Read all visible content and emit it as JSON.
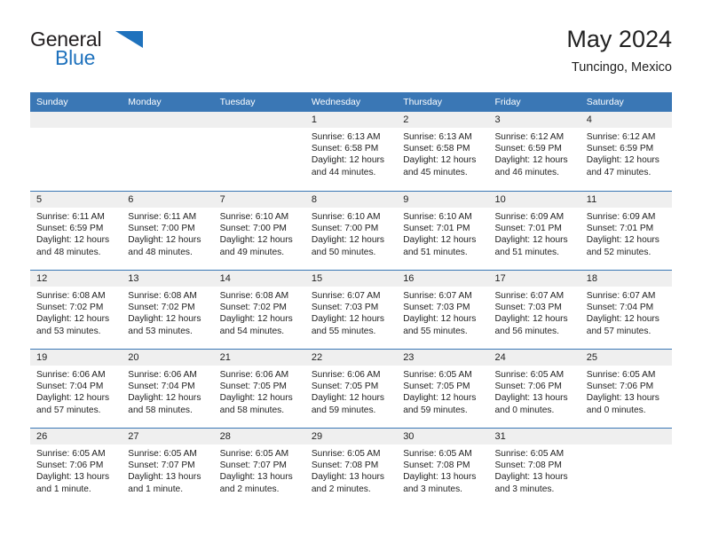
{
  "brand": {
    "name_part1": "General",
    "name_part2": "Blue",
    "accent_color": "#1f72bd",
    "logo_icon": "triangle-icon"
  },
  "header": {
    "title": "May 2024",
    "subtitle": "Tuncingo, Mexico"
  },
  "theme": {
    "header_bg": "#3a77b5",
    "daynum_bg": "#efefef",
    "divider": "#3a77b5",
    "text": "#222222"
  },
  "calendar": {
    "weekday_headers": [
      "Sunday",
      "Monday",
      "Tuesday",
      "Wednesday",
      "Thursday",
      "Friday",
      "Saturday"
    ],
    "weeks": [
      [
        {
          "day": "",
          "lines": []
        },
        {
          "day": "",
          "lines": []
        },
        {
          "day": "",
          "lines": []
        },
        {
          "day": "1",
          "lines": [
            "Sunrise: 6:13 AM",
            "Sunset: 6:58 PM",
            "Daylight: 12 hours",
            "and 44 minutes."
          ]
        },
        {
          "day": "2",
          "lines": [
            "Sunrise: 6:13 AM",
            "Sunset: 6:58 PM",
            "Daylight: 12 hours",
            "and 45 minutes."
          ]
        },
        {
          "day": "3",
          "lines": [
            "Sunrise: 6:12 AM",
            "Sunset: 6:59 PM",
            "Daylight: 12 hours",
            "and 46 minutes."
          ]
        },
        {
          "day": "4",
          "lines": [
            "Sunrise: 6:12 AM",
            "Sunset: 6:59 PM",
            "Daylight: 12 hours",
            "and 47 minutes."
          ]
        }
      ],
      [
        {
          "day": "5",
          "lines": [
            "Sunrise: 6:11 AM",
            "Sunset: 6:59 PM",
            "Daylight: 12 hours",
            "and 48 minutes."
          ]
        },
        {
          "day": "6",
          "lines": [
            "Sunrise: 6:11 AM",
            "Sunset: 7:00 PM",
            "Daylight: 12 hours",
            "and 48 minutes."
          ]
        },
        {
          "day": "7",
          "lines": [
            "Sunrise: 6:10 AM",
            "Sunset: 7:00 PM",
            "Daylight: 12 hours",
            "and 49 minutes."
          ]
        },
        {
          "day": "8",
          "lines": [
            "Sunrise: 6:10 AM",
            "Sunset: 7:00 PM",
            "Daylight: 12 hours",
            "and 50 minutes."
          ]
        },
        {
          "day": "9",
          "lines": [
            "Sunrise: 6:10 AM",
            "Sunset: 7:01 PM",
            "Daylight: 12 hours",
            "and 51 minutes."
          ]
        },
        {
          "day": "10",
          "lines": [
            "Sunrise: 6:09 AM",
            "Sunset: 7:01 PM",
            "Daylight: 12 hours",
            "and 51 minutes."
          ]
        },
        {
          "day": "11",
          "lines": [
            "Sunrise: 6:09 AM",
            "Sunset: 7:01 PM",
            "Daylight: 12 hours",
            "and 52 minutes."
          ]
        }
      ],
      [
        {
          "day": "12",
          "lines": [
            "Sunrise: 6:08 AM",
            "Sunset: 7:02 PM",
            "Daylight: 12 hours",
            "and 53 minutes."
          ]
        },
        {
          "day": "13",
          "lines": [
            "Sunrise: 6:08 AM",
            "Sunset: 7:02 PM",
            "Daylight: 12 hours",
            "and 53 minutes."
          ]
        },
        {
          "day": "14",
          "lines": [
            "Sunrise: 6:08 AM",
            "Sunset: 7:02 PM",
            "Daylight: 12 hours",
            "and 54 minutes."
          ]
        },
        {
          "day": "15",
          "lines": [
            "Sunrise: 6:07 AM",
            "Sunset: 7:03 PM",
            "Daylight: 12 hours",
            "and 55 minutes."
          ]
        },
        {
          "day": "16",
          "lines": [
            "Sunrise: 6:07 AM",
            "Sunset: 7:03 PM",
            "Daylight: 12 hours",
            "and 55 minutes."
          ]
        },
        {
          "day": "17",
          "lines": [
            "Sunrise: 6:07 AM",
            "Sunset: 7:03 PM",
            "Daylight: 12 hours",
            "and 56 minutes."
          ]
        },
        {
          "day": "18",
          "lines": [
            "Sunrise: 6:07 AM",
            "Sunset: 7:04 PM",
            "Daylight: 12 hours",
            "and 57 minutes."
          ]
        }
      ],
      [
        {
          "day": "19",
          "lines": [
            "Sunrise: 6:06 AM",
            "Sunset: 7:04 PM",
            "Daylight: 12 hours",
            "and 57 minutes."
          ]
        },
        {
          "day": "20",
          "lines": [
            "Sunrise: 6:06 AM",
            "Sunset: 7:04 PM",
            "Daylight: 12 hours",
            "and 58 minutes."
          ]
        },
        {
          "day": "21",
          "lines": [
            "Sunrise: 6:06 AM",
            "Sunset: 7:05 PM",
            "Daylight: 12 hours",
            "and 58 minutes."
          ]
        },
        {
          "day": "22",
          "lines": [
            "Sunrise: 6:06 AM",
            "Sunset: 7:05 PM",
            "Daylight: 12 hours",
            "and 59 minutes."
          ]
        },
        {
          "day": "23",
          "lines": [
            "Sunrise: 6:05 AM",
            "Sunset: 7:05 PM",
            "Daylight: 12 hours",
            "and 59 minutes."
          ]
        },
        {
          "day": "24",
          "lines": [
            "Sunrise: 6:05 AM",
            "Sunset: 7:06 PM",
            "Daylight: 13 hours",
            "and 0 minutes."
          ]
        },
        {
          "day": "25",
          "lines": [
            "Sunrise: 6:05 AM",
            "Sunset: 7:06 PM",
            "Daylight: 13 hours",
            "and 0 minutes."
          ]
        }
      ],
      [
        {
          "day": "26",
          "lines": [
            "Sunrise: 6:05 AM",
            "Sunset: 7:06 PM",
            "Daylight: 13 hours",
            "and 1 minute."
          ]
        },
        {
          "day": "27",
          "lines": [
            "Sunrise: 6:05 AM",
            "Sunset: 7:07 PM",
            "Daylight: 13 hours",
            "and 1 minute."
          ]
        },
        {
          "day": "28",
          "lines": [
            "Sunrise: 6:05 AM",
            "Sunset: 7:07 PM",
            "Daylight: 13 hours",
            "and 2 minutes."
          ]
        },
        {
          "day": "29",
          "lines": [
            "Sunrise: 6:05 AM",
            "Sunset: 7:08 PM",
            "Daylight: 13 hours",
            "and 2 minutes."
          ]
        },
        {
          "day": "30",
          "lines": [
            "Sunrise: 6:05 AM",
            "Sunset: 7:08 PM",
            "Daylight: 13 hours",
            "and 3 minutes."
          ]
        },
        {
          "day": "31",
          "lines": [
            "Sunrise: 6:05 AM",
            "Sunset: 7:08 PM",
            "Daylight: 13 hours",
            "and 3 minutes."
          ]
        },
        {
          "day": "",
          "lines": []
        }
      ]
    ]
  }
}
